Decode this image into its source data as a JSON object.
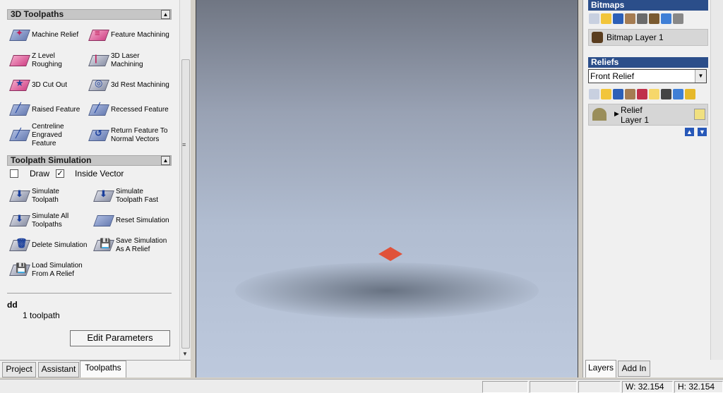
{
  "left_panel": {
    "toolpaths_section": {
      "title": "3D Toolpaths",
      "tools": [
        {
          "label": "Machine Relief",
          "icon": "machine-relief-icon"
        },
        {
          "label": "Feature Machining",
          "icon": "feature-machining-icon"
        },
        {
          "label": "Z Level\nRoughing",
          "icon": "z-level-roughing-icon"
        },
        {
          "label": "3D Laser\nMachining",
          "icon": "laser-machining-icon"
        },
        {
          "label": "3D Cut Out",
          "icon": "cut-out-icon"
        },
        {
          "label": "3d Rest Machining",
          "icon": "rest-machining-icon"
        },
        {
          "label": "Raised Feature",
          "icon": "raised-feature-icon"
        },
        {
          "label": "Recessed Feature",
          "icon": "recessed-feature-icon"
        },
        {
          "label": "Centreline\nEngraved\nFeature",
          "icon": "centreline-engraved-icon"
        },
        {
          "label": "Return Feature To\nNormal Vectors",
          "icon": "return-feature-icon"
        }
      ]
    },
    "simulation_section": {
      "title": "Toolpath Simulation",
      "draw_label": "Draw",
      "draw_checked": false,
      "inside_vector_label": "Inside Vector",
      "inside_vector_checked": true,
      "tools": [
        {
          "label": "Simulate\nToolpath",
          "icon": "simulate-toolpath-icon"
        },
        {
          "label": "Simulate\nToolpath Fast",
          "icon": "simulate-fast-icon"
        },
        {
          "label": "Simulate All\nToolpaths",
          "icon": "simulate-all-icon"
        },
        {
          "label": "Reset Simulation",
          "icon": "reset-simulation-icon"
        },
        {
          "label": "Delete Simulation",
          "icon": "delete-simulation-icon"
        },
        {
          "label": "Save Simulation\nAs A Relief",
          "icon": "save-simulation-icon"
        },
        {
          "label": "Load Simulation\nFrom A Relief",
          "icon": "load-simulation-icon"
        }
      ]
    },
    "toolpath_name": "dd",
    "toolpath_count": "1 toolpath",
    "edit_button": "Edit Parameters",
    "tabs": [
      "Project",
      "Assistant",
      "Toolpaths"
    ],
    "active_tab": "Toolpaths"
  },
  "right_panel": {
    "bitmaps": {
      "title": "Bitmaps",
      "layer": "Bitmap Layer 1"
    },
    "reliefs": {
      "title": "Reliefs",
      "selected": "Front Relief",
      "layer_line1": "Relief",
      "layer_line2": "Layer 1"
    },
    "tabs": [
      "Layers",
      "Add In"
    ],
    "active_tab": "Layers"
  },
  "status": {
    "width": "W: 32.154",
    "height": "H: 32.154"
  },
  "colors": {
    "panel_header": "#2b4e8a",
    "model": "#e0523a"
  }
}
